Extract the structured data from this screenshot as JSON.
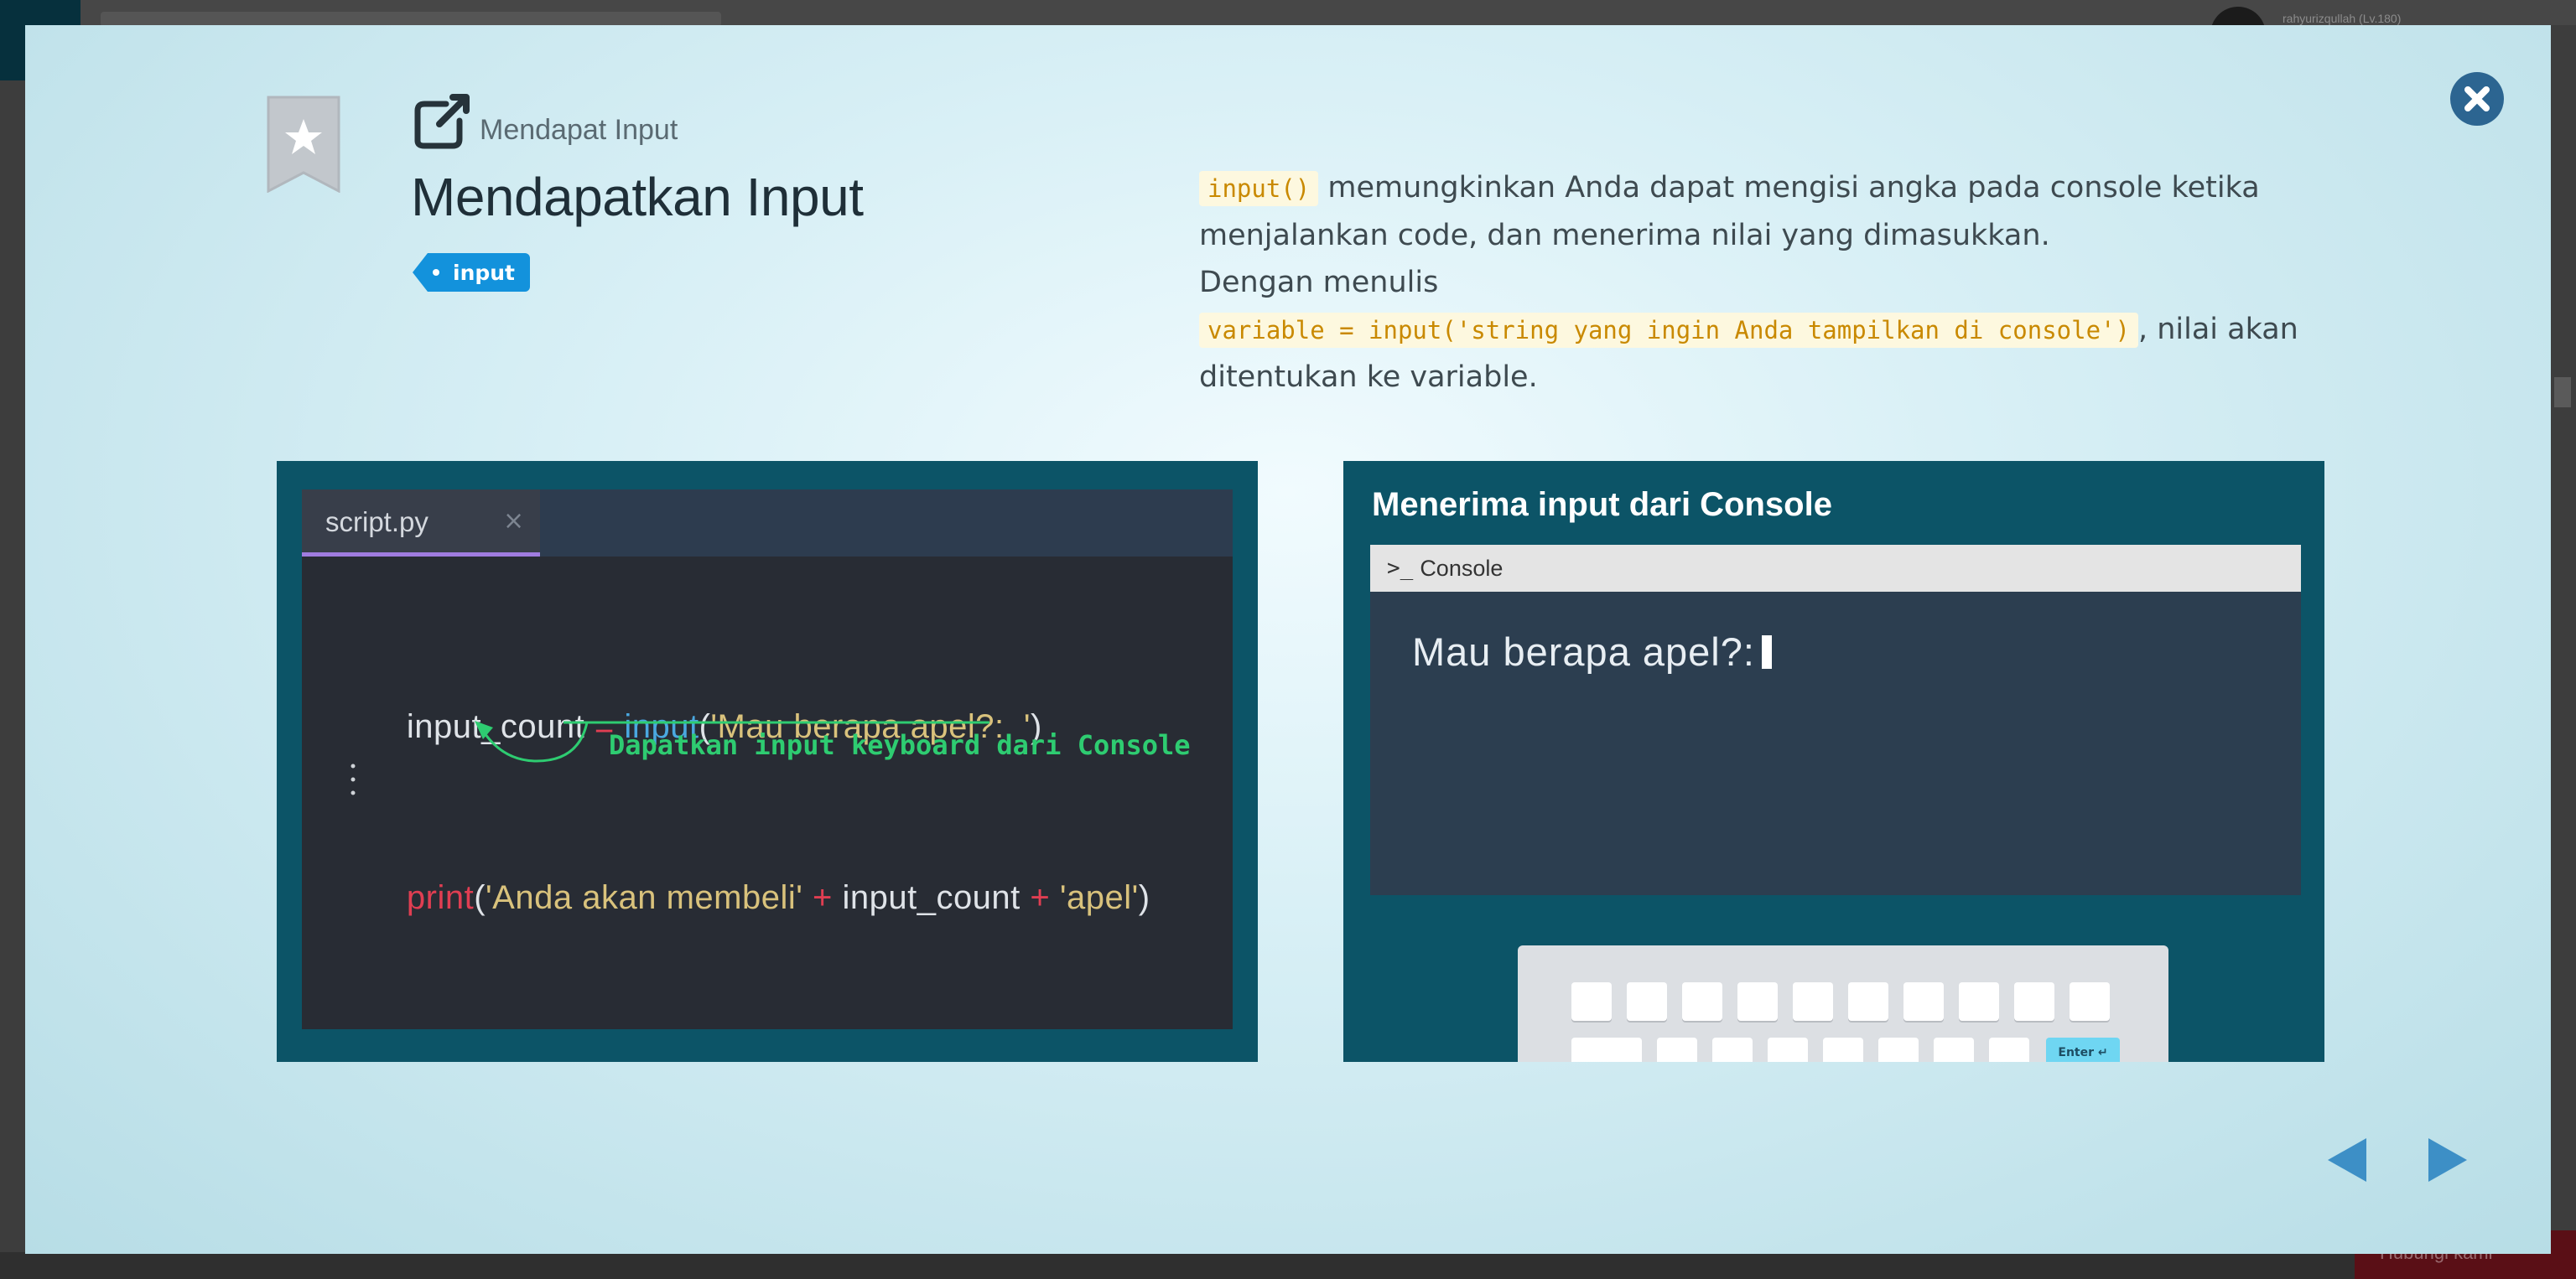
{
  "background": {
    "username": "rahyurizqullah (Lv.180)",
    "contact_button": "Hubungi kami"
  },
  "lesson": {
    "subtitle": "Mendapat Input",
    "title": "Mendapatkan Input",
    "tag": "input",
    "description": {
      "code1": "input()",
      "text1": " memungkinkan Anda dapat mengisi angka pada console ketika menjalankan code, dan menerima nilai yang dimasukkan.",
      "text2": "Dengan menulis",
      "code2": "variable = input('string yang ingin Anda tampilkan di console')",
      "text3": ", nilai akan ditentukan ke variable."
    }
  },
  "editor": {
    "tab_label": "script.py",
    "tab_close": "×",
    "line1": {
      "var": "input_count",
      "eq": " = ",
      "fn": "input",
      "open": "(",
      "str": "'Mau berapa apel?:  '",
      "close": ")"
    },
    "annotation": "Dapatkan input keyboard dari Console",
    "line2": {
      "fn": "print",
      "open": "(",
      "str1": "'Anda akan membeli'",
      "plus1": " + ",
      "var": "input_count",
      "plus2": " + ",
      "str2": "'apel'",
      "close": ")"
    }
  },
  "console": {
    "heading": "Menerima input dari Console",
    "bar_label": "Console",
    "prompt_icon": ">_",
    "prompt_text": "Mau berapa apel?:",
    "enter_key": "Enter ↵"
  },
  "colors": {
    "panel_bg": "#0c5467",
    "tag_blue": "#1392dc",
    "close_button": "#2c6591",
    "nav_arrow": "#3d8fc6"
  }
}
